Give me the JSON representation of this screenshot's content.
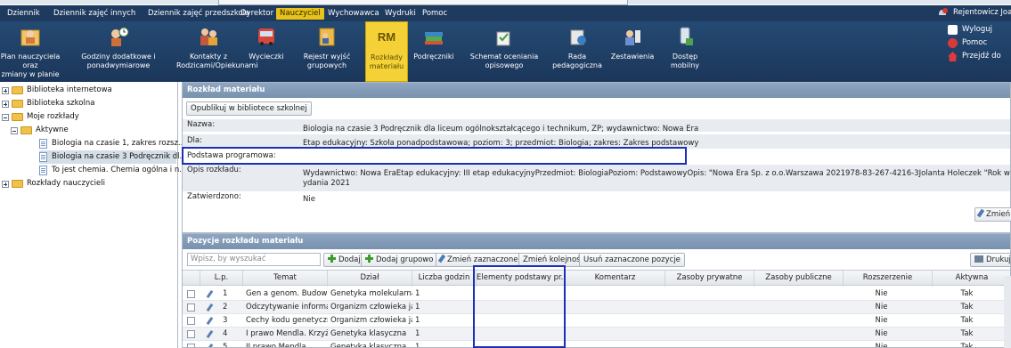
{
  "menu": [
    "Dziennik",
    "Dziennik zajęć innych",
    "Dziennik zajęć przedszkola",
    "Dyrektor",
    "Nauczyciel",
    "Wychowawca",
    "Wydruki",
    "Pomoc"
  ],
  "user": "Rejentowicz Joanna [",
  "toolbar": [
    {
      "l1": "Plan nauczyciela oraz",
      "l2": "zmiany w planie",
      "icon": "calendar-user-icon"
    },
    {
      "l1": "Godziny dodatkowe i",
      "l2": "ponadwymiarowe",
      "icon": "hours-icon"
    },
    {
      "l1": "Kontakty z",
      "l2": "Rodzicami/Opiekunami",
      "icon": "contacts-icon"
    },
    {
      "l1": "Wycieczki",
      "l2": "",
      "icon": "bus-icon"
    },
    {
      "l1": "Rejestr wyjść",
      "l2": "grupowych",
      "icon": "register-icon"
    },
    {
      "l1": "Rozkłady",
      "l2": "materiału",
      "icon": "rm-icon",
      "rm": "RM"
    },
    {
      "l1": "Podręczniki",
      "l2": "",
      "icon": "books-icon"
    },
    {
      "l1": "Schemat oceniania",
      "l2": "opisowego",
      "icon": "scheme-icon"
    },
    {
      "l1": "Rada",
      "l2": "pedagogiczna",
      "icon": "council-icon"
    },
    {
      "l1": "Zestawienia",
      "l2": "",
      "icon": "stats-icon"
    },
    {
      "l1": "Dostęp",
      "l2": "mobilny",
      "icon": "mobile-icon"
    }
  ],
  "right_links": [
    "Wyloguj",
    "Pomoc",
    "Przejdź do"
  ],
  "tree": [
    {
      "label": "Biblioteka internetowa"
    },
    {
      "label": "Biblioteka szkolna"
    },
    {
      "label": "Moje rozkłady"
    },
    {
      "label": "Aktywne"
    },
    {
      "label": "Biologia na czasie 1, zakres rozsz..."
    },
    {
      "label": "Biologia na czasie 3 Podręcznik dl..."
    },
    {
      "label": "To jest chemia. Chemia ogólna i n..."
    },
    {
      "label": "Rozkłady nauczycieli"
    }
  ],
  "panel1": {
    "title": "Rozkład materiału",
    "publish": "Opublikuj w bibliotece szkolnej",
    "nazwa_l": "Nazwa:",
    "nazwa": "Biologia na czasie 3 Podręcznik dla liceum ogólnokształcącego i technikum, ZP; wydawnictwo: Nowa Era",
    "dla_l": "Dla:",
    "dla": "Etap edukacyjny: Szkoła ponadpodstawowa; poziom: 3; przedmiot: Biologia; zakres: Zakres podstawowy",
    "podstawa_l": "Podstawa programowa:",
    "opis_l": "Opis rozkładu:",
    "opis1": "Wydawnictwo:  Nowa EraEtap edukacyjny:  III etap edukacyjnyPrzedmiot:     BiologiaPoziom:  PodstawowyOpis:      \"Nowa Era Sp. z o.o.Warszawa 2021978-83-267-4216-3Jolanta Holeczek \"Rok w",
    "opis2": "ydania     2021",
    "zatw_l": "Zatwierdzono:",
    "zatw": "Nie",
    "edit": "Zmień"
  },
  "panel2": {
    "title": "Pozycje rozkładu materiału",
    "search_ph": "Wpisz, by wyszukać",
    "buttons": [
      "Dodaj",
      "Dodaj grupowo",
      "Zmień zaznaczone",
      "Zmień kolejność",
      "Usuń zaznaczone pozycje"
    ],
    "print": "Drukuj",
    "headers": [
      "L.p.",
      "Temat",
      "Dział",
      "Liczba godzin",
      "Elementy podstawy pr...",
      "Komentarz",
      "Zasoby prywatne",
      "Zasoby publiczne",
      "Rozszerzenie",
      "Aktywna"
    ],
    "rows": [
      [
        "1",
        "Gen a genom. Budowa...",
        "Genetyka molekularna",
        "1",
        "",
        "",
        "",
        "",
        "Nie",
        "Tak"
      ],
      [
        "2",
        "Odczytywanie informa...",
        "Organizm człowieka ja...",
        "1",
        "",
        "",
        "",
        "",
        "Nie",
        "Tak"
      ],
      [
        "3",
        "Cechy kodu genetyczn...",
        "Organizm człowieka ja...",
        "1",
        "",
        "",
        "",
        "",
        "Nie",
        "Tak"
      ],
      [
        "4",
        "I prawo Mendla. Krzyż...",
        "Genetyka klasyczna",
        "1",
        "",
        "",
        "",
        "",
        "Nie",
        "Tak"
      ],
      [
        "5",
        "II prawo Mendla",
        "Genetyka klasyczna",
        "1",
        "",
        "",
        "",
        "",
        "Nie",
        "Tak"
      ]
    ]
  }
}
